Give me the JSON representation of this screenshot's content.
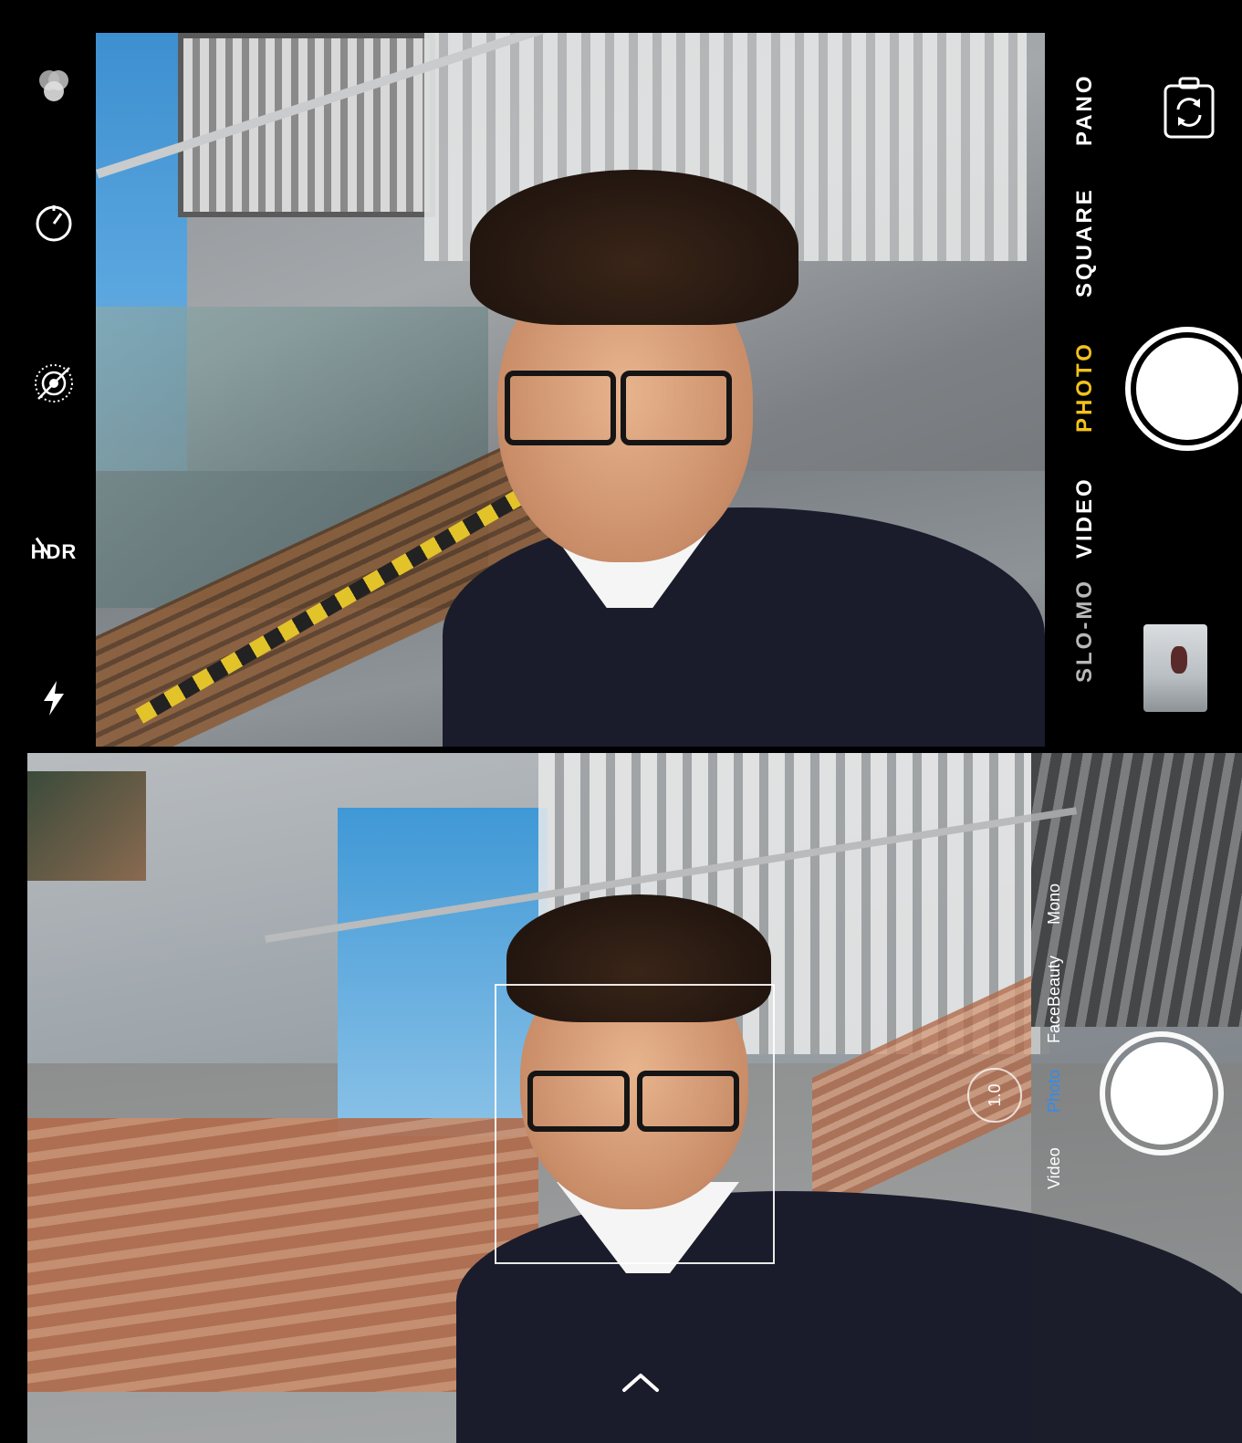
{
  "top_camera": {
    "left_controls": [
      {
        "name": "filters",
        "icon": "filters-icon"
      },
      {
        "name": "timer",
        "icon": "timer-icon"
      },
      {
        "name": "live-photo",
        "icon": "live-photo-off-icon"
      },
      {
        "name": "hdr",
        "icon": "hdr-off-icon",
        "label": "HDR"
      },
      {
        "name": "flash",
        "icon": "flash-icon"
      }
    ],
    "modes": [
      "PANO",
      "SQUARE",
      "PHOTO",
      "VIDEO",
      "SLO-MO"
    ],
    "active_mode": "PHOTO",
    "accent_color": "#f2c21b",
    "flip_icon": "camera-flip-icon",
    "thumbnail": "last-photo-thumbnail"
  },
  "bottom_camera": {
    "modes": [
      "Mono",
      "FaceBeauty",
      "Photo",
      "Video"
    ],
    "active_mode": "Photo",
    "accent_color": "#2f8cf0",
    "zoom": "1.0",
    "chevron_icon": "chevron-up-icon"
  }
}
